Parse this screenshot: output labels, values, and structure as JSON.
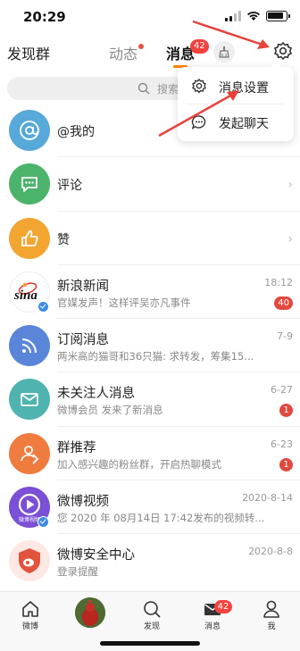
{
  "status_bar": {
    "time": "20:29"
  },
  "header": {
    "left_label": "发现群",
    "tab_dynamic": "动态",
    "tab_messages": "消息",
    "messages_badge": "42"
  },
  "search": {
    "placeholder": "搜索"
  },
  "popup_menu": {
    "items": [
      {
        "label": "消息设置",
        "icon": "gear-icon"
      },
      {
        "label": "发起聊天",
        "icon": "chat-bubble-icon"
      }
    ]
  },
  "messages": [
    {
      "title": "@我的",
      "icon": "at-icon",
      "color": "#57a9d9"
    },
    {
      "title": "评论",
      "icon": "comment-icon",
      "color": "#4cb36a"
    },
    {
      "title": "赞",
      "icon": "thumbs-up-icon",
      "color": "#f3a531"
    },
    {
      "title": "新浪新闻",
      "subtitle": "官媒发声！这样评吴亦凡事件",
      "time": "18:12",
      "badge": "40",
      "icon": "sina-logo"
    },
    {
      "title": "订阅消息",
      "subtitle": "两米高的猫哥和36只猫: 求转发，筹集15...",
      "time": "7-9",
      "icon": "rss-icon",
      "color": "#5b85d8"
    },
    {
      "title": "未关注人消息",
      "subtitle": "微博会员 发来了新消息",
      "time": "6-27",
      "badge": "1",
      "icon": "mail-icon",
      "color": "#4fb3b0"
    },
    {
      "title": "群推荐",
      "subtitle": "加入感兴趣的粉丝群，开启热聊模式",
      "time": "6-23",
      "badge": "1",
      "icon": "group-icon",
      "color": "#f07b3f"
    },
    {
      "title": "微博视频",
      "subtitle": "您 2020 年 08月14日 17:42发布的视频转...",
      "time": "2020-8-14",
      "icon": "video-play-icon",
      "color": "#7b4fd6",
      "avatar_label": "微博视频"
    },
    {
      "title": "微博安全中心",
      "subtitle": "登录提醒",
      "time": "2020-8-8",
      "icon": "shield-icon",
      "color": "#e2533d"
    }
  ],
  "tab_bar": {
    "items": [
      {
        "label": "微博",
        "icon": "home-icon"
      },
      {
        "label": "",
        "icon": "avatar"
      },
      {
        "label": "发现",
        "icon": "search-icon"
      },
      {
        "label": "消息",
        "icon": "mail-icon",
        "badge": "42"
      },
      {
        "label": "我",
        "icon": "person-icon"
      }
    ]
  },
  "colors": {
    "accent": "#ff8200",
    "badge_red": "#f3423e",
    "annotation_arrow": "#e8413a"
  }
}
